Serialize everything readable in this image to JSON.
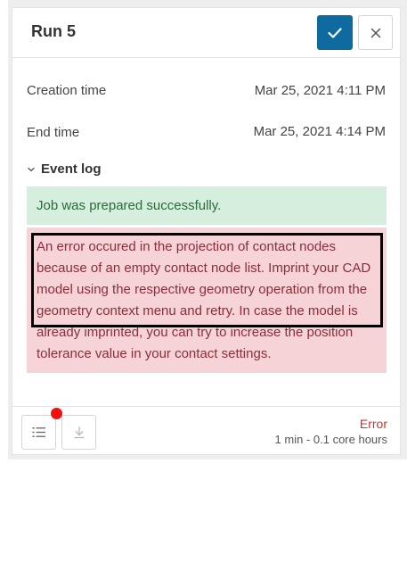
{
  "header": {
    "title": "Run 5"
  },
  "details": {
    "creation_label": "Creation time",
    "creation_value": "Mar 25, 2021 4:11 PM",
    "end_label": "End time",
    "end_value": "Mar 25, 2021 4:14 PM"
  },
  "event_log": {
    "toggle_label": "Event log",
    "success_message": "Job was prepared successfully.",
    "error_message": "An error occured in the projection of contact nodes because of an empty contact node list. Imprint your CAD model using the respective geometry operation from the geometry context menu and retry. In case the model is already imprinted, you can try to increase the position tolerance value in your contact settings."
  },
  "footer": {
    "status": "Error",
    "usage": "1 min - 0.1 core hours"
  },
  "icons": {
    "confirm": "check-icon",
    "close": "close-icon",
    "toggle": "chevron-down-icon",
    "list": "list-icon",
    "download": "download-icon"
  },
  "colors": {
    "accent": "#0f6b9f",
    "success_bg": "#d6eedd",
    "error_bg": "#f5d3d6",
    "error_text": "#cc3333",
    "notification": "#ee1111"
  }
}
